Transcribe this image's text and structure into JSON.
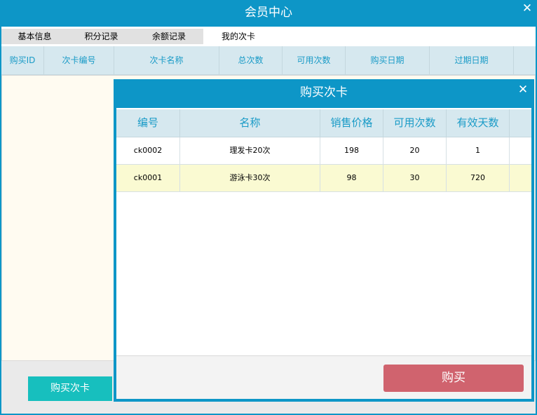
{
  "window": {
    "title": "会员中心",
    "close_glyph": "✕"
  },
  "tabs": [
    {
      "label": "基本信息",
      "active": false
    },
    {
      "label": "积分记录",
      "active": false
    },
    {
      "label": "余额记录",
      "active": false
    },
    {
      "label": "我的次卡",
      "active": true
    }
  ],
  "member_table": {
    "columns": [
      "购买ID",
      "次卡编号",
      "次卡名称",
      "总次数",
      "可用次数",
      "购买日期",
      "过期日期"
    ]
  },
  "buy_card_button": "购买次卡",
  "dialog": {
    "title": "购买次卡",
    "close_glyph": "✕",
    "columns": [
      "编号",
      "名称",
      "销售价格",
      "可用次数",
      "有效天数"
    ],
    "rows": [
      {
        "code": "ck0002",
        "name": "理发卡20次",
        "price": "198",
        "uses": "20",
        "days": "1"
      },
      {
        "code": "ck0001",
        "name": "游泳卡30次",
        "price": "98",
        "uses": "30",
        "days": "720"
      }
    ],
    "buy_label": "购买"
  },
  "colors": {
    "accent": "#0d96c7",
    "header_text": "#1a9bc7",
    "teal_button": "#17bfbe",
    "buy_button": "#d0636e",
    "row_highlight": "#fafad2"
  }
}
